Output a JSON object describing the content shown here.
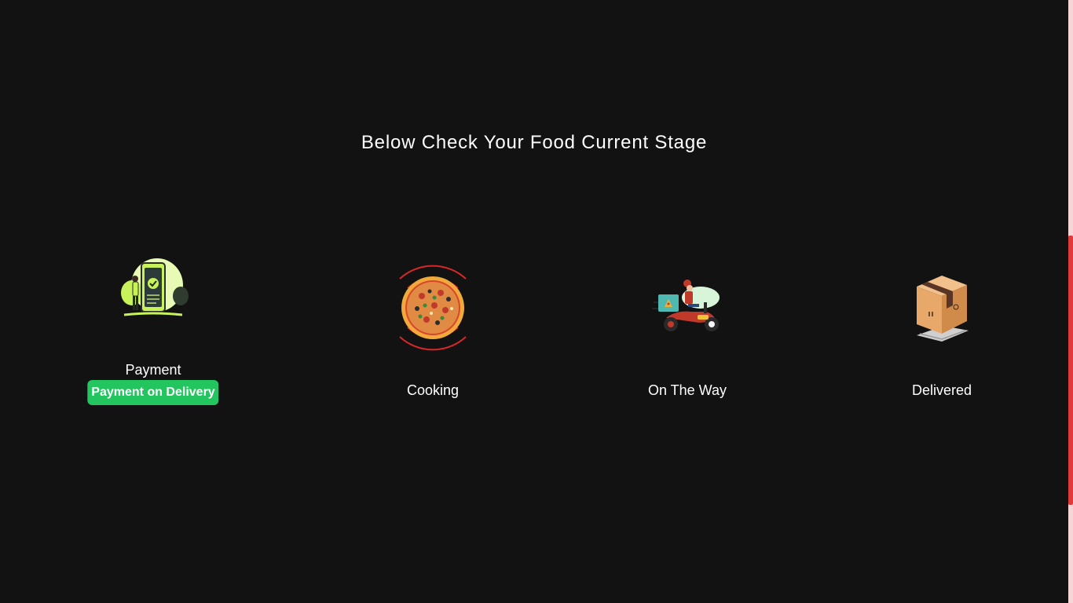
{
  "heading": "Below Check Your Food Current Stage",
  "stages": [
    {
      "label": "Payment",
      "icon": "payment-phone-icon",
      "badge": "Payment on Delivery"
    },
    {
      "label": "Cooking",
      "icon": "pizza-icon",
      "active": true
    },
    {
      "label": "On The Way",
      "icon": "delivery-scooter-icon"
    },
    {
      "label": "Delivered",
      "icon": "package-box-icon"
    }
  ],
  "colors": {
    "background": "#121212",
    "badge": "#22c55e",
    "active_ring": "#d62828",
    "scrollbar_thumb": "#e23a3a"
  }
}
